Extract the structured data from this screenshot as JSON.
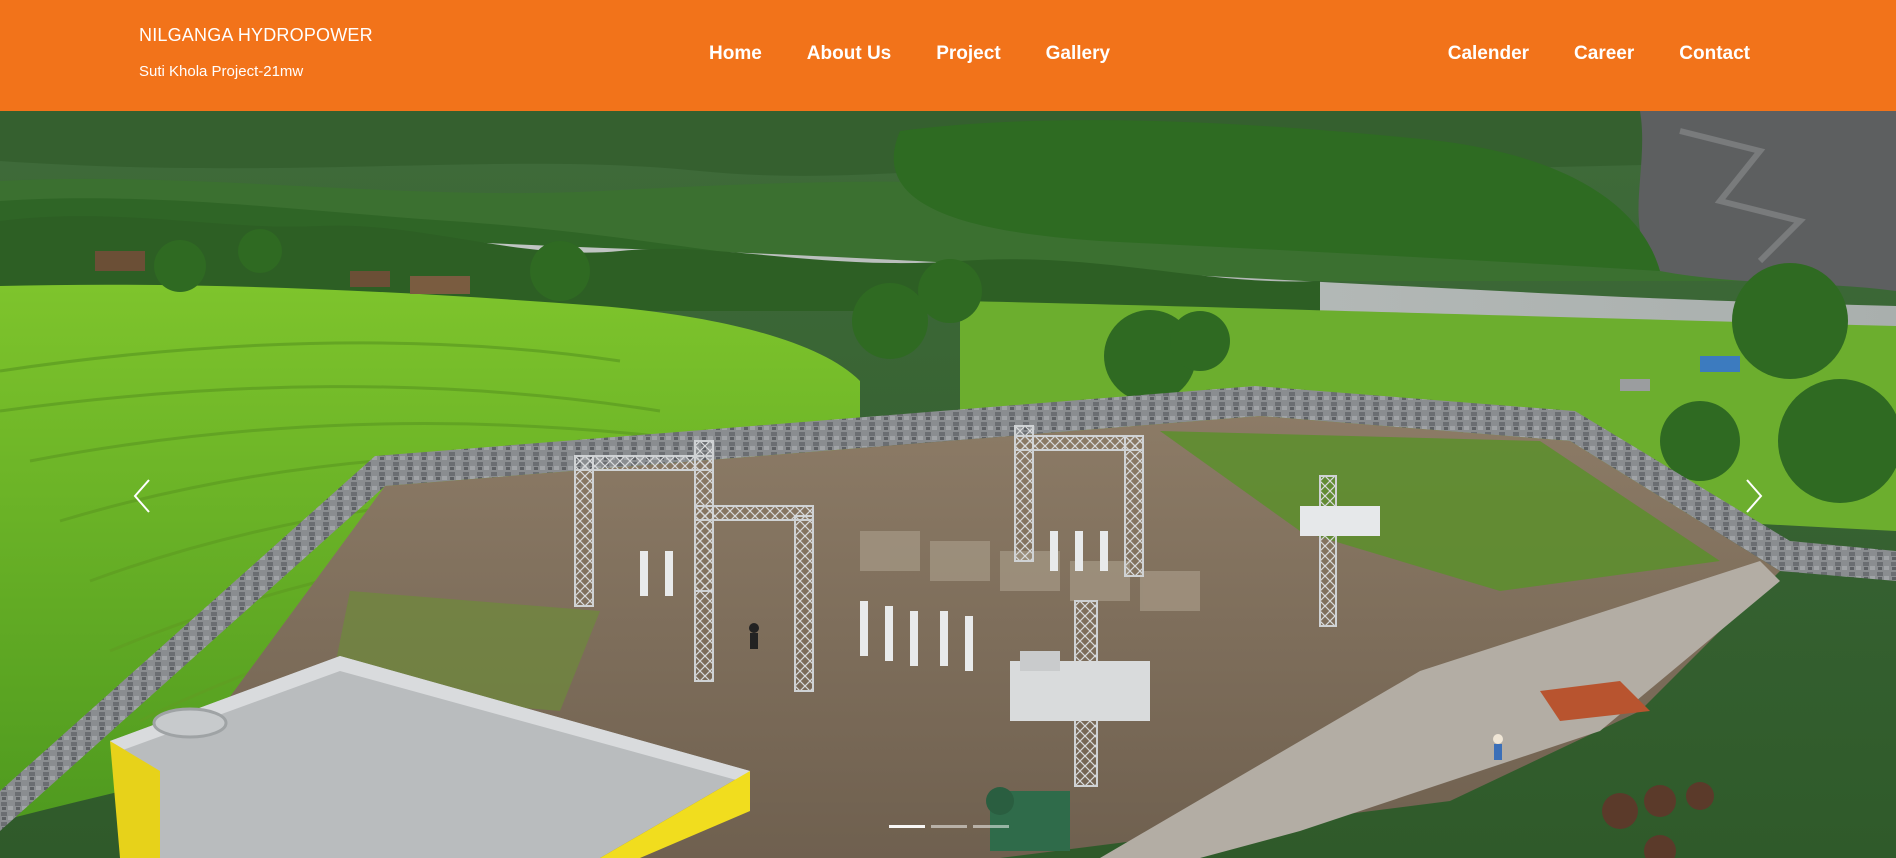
{
  "header": {
    "brand_title": "NILGANGA HYDROPOWER",
    "brand_subtitle": "Suti Khola Project-21mw",
    "background_color": "#f2731a"
  },
  "nav": {
    "center": [
      {
        "label": "Home"
      },
      {
        "label": "About Us"
      },
      {
        "label": "Project"
      },
      {
        "label": "Gallery"
      }
    ],
    "right": [
      {
        "label": "Calender"
      },
      {
        "label": "Career"
      },
      {
        "label": "Contact"
      }
    ]
  },
  "carousel": {
    "prev_icon": "chevron-left-icon",
    "next_icon": "chevron-right-icon",
    "slide_count": 3,
    "active_slide": 1,
    "image_description_icon": "substation-photo"
  }
}
